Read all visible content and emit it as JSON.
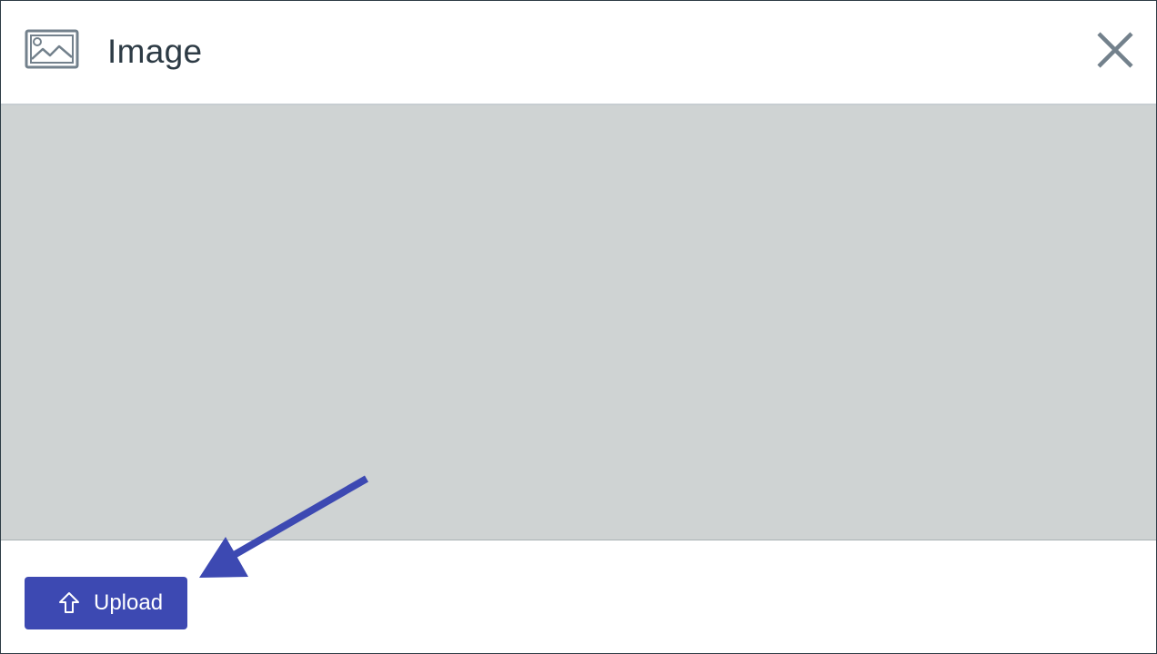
{
  "dialog": {
    "title": "Image",
    "title_icon": "image-icon",
    "close_icon": "close-icon"
  },
  "footer": {
    "upload_label": "Upload",
    "upload_icon": "upload-arrow-icon"
  },
  "colors": {
    "accent": "#3d49b2",
    "title_text": "#2d3b45",
    "icon_gray": "#73818c",
    "preview_bg": "#cfd3d3",
    "annotation_arrow": "#3d49b2"
  }
}
